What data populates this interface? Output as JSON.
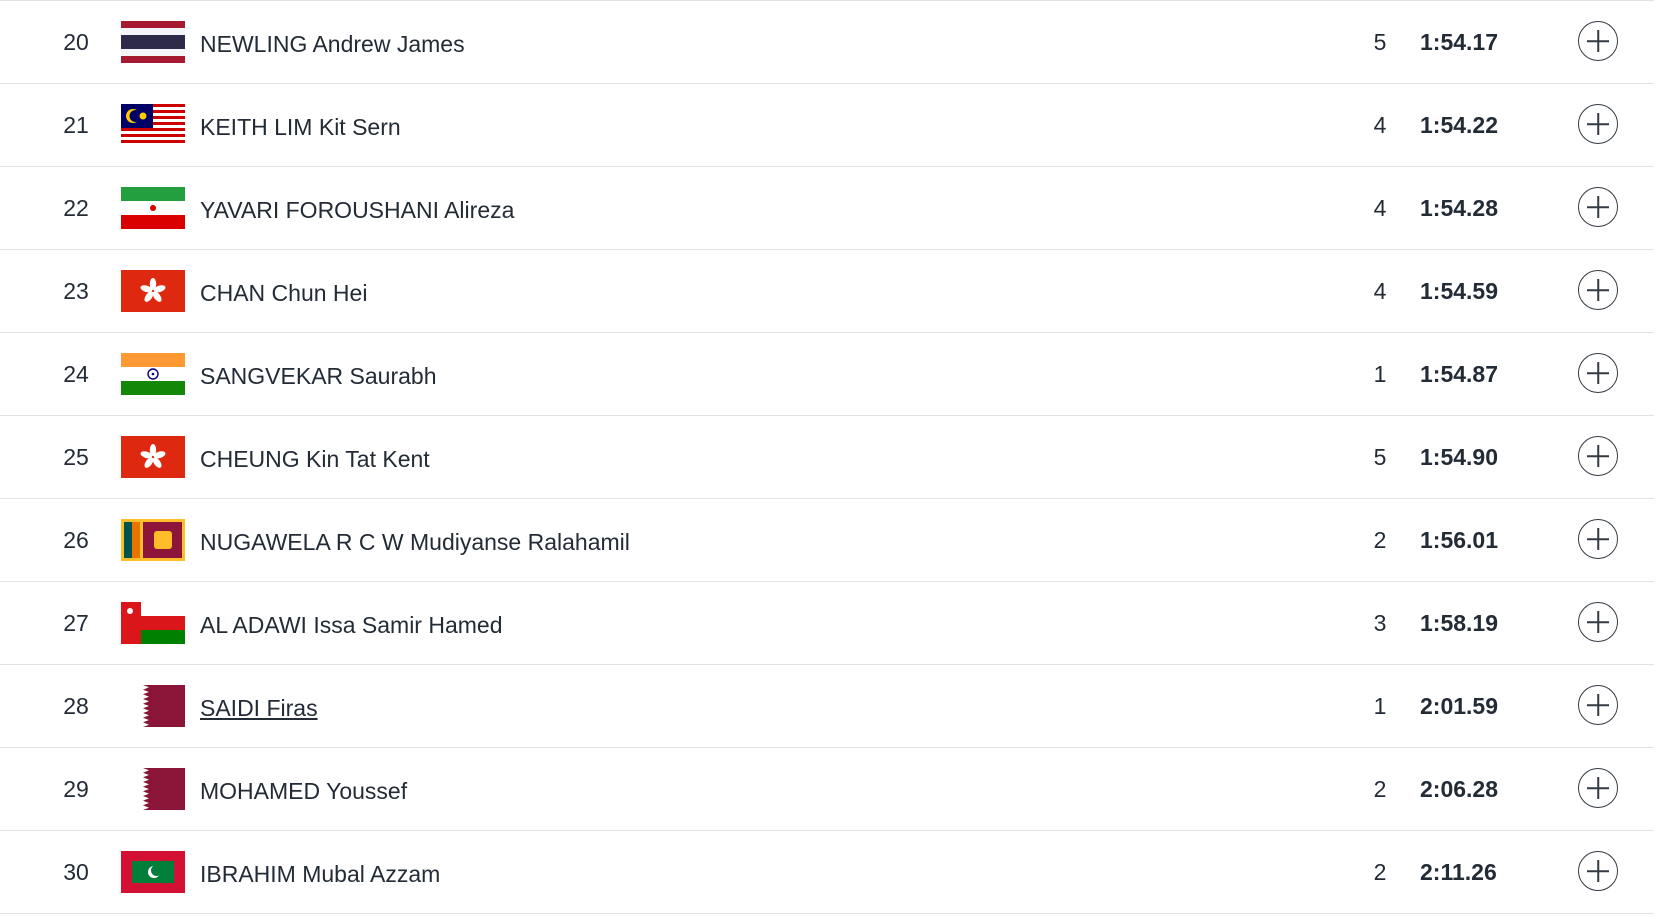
{
  "rows": [
    {
      "rank": "20",
      "flag": "thailand-flag-icon",
      "name": "NEWLING Andrew James",
      "heat": "5",
      "time": "1:54.17",
      "linked": false
    },
    {
      "rank": "21",
      "flag": "malaysia-flag-icon",
      "name": "KEITH LIM Kit Sern",
      "heat": "4",
      "time": "1:54.22",
      "linked": false
    },
    {
      "rank": "22",
      "flag": "iran-flag-icon",
      "name": "YAVARI FOROUSHANI Alireza",
      "heat": "4",
      "time": "1:54.28",
      "linked": false
    },
    {
      "rank": "23",
      "flag": "hong-kong-flag-icon",
      "name": "CHAN Chun Hei",
      "heat": "4",
      "time": "1:54.59",
      "linked": false
    },
    {
      "rank": "24",
      "flag": "india-flag-icon",
      "name": "SANGVEKAR Saurabh",
      "heat": "1",
      "time": "1:54.87",
      "linked": false
    },
    {
      "rank": "25",
      "flag": "hong-kong-flag-icon",
      "name": "CHEUNG Kin Tat Kent",
      "heat": "5",
      "time": "1:54.90",
      "linked": false
    },
    {
      "rank": "26",
      "flag": "sri-lanka-flag-icon",
      "name": "NUGAWELA R C W Mudiyanse Ralahamil",
      "heat": "2",
      "time": "1:56.01",
      "linked": false
    },
    {
      "rank": "27",
      "flag": "oman-flag-icon",
      "name": "AL ADAWI Issa Samir Hamed",
      "heat": "3",
      "time": "1:58.19",
      "linked": false
    },
    {
      "rank": "28",
      "flag": "qatar-flag-icon",
      "name": "SAIDI Firas",
      "heat": "1",
      "time": "2:01.59",
      "linked": true
    },
    {
      "rank": "29",
      "flag": "qatar-flag-icon",
      "name": "MOHAMED Youssef",
      "heat": "2",
      "time": "2:06.28",
      "linked": false
    },
    {
      "rank": "30",
      "flag": "maldives-flag-icon",
      "name": "IBRAHIM Mubal Azzam",
      "heat": "2",
      "time": "2:11.26",
      "linked": false
    }
  ],
  "icons": {
    "expand": "plus-circle-icon"
  },
  "colors": {
    "text": "#222b36",
    "divider": "#e2e2e2"
  }
}
